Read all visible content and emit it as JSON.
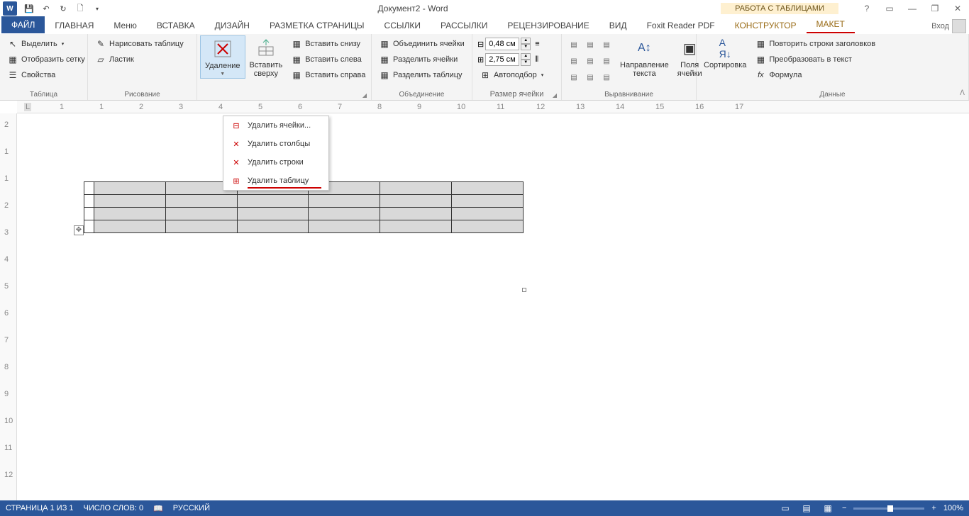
{
  "title": "Документ2 - Word",
  "contextTab": "РАБОТА С ТАБЛИЦАМИ",
  "tabs": {
    "file": "ФАЙЛ",
    "home": "ГЛАВНАЯ",
    "menu": "Меню",
    "insert": "ВСТАВКА",
    "design": "ДИЗАЙН",
    "layout": "РАЗМЕТКА СТРАНИЦЫ",
    "refs": "ССЫЛКИ",
    "mail": "РАССЫЛКИ",
    "review": "РЕЦЕНЗИРОВАНИЕ",
    "view": "ВИД",
    "foxit": "Foxit Reader PDF",
    "constructor": "КОНСТРУКТОР",
    "maket": "МАКЕТ",
    "signin": "Вход"
  },
  "groups": {
    "table": {
      "label": "Таблица",
      "select": "Выделить",
      "grid": "Отобразить сетку",
      "props": "Свойства"
    },
    "draw": {
      "label": "Рисование",
      "draw": "Нарисовать таблицу",
      "eraser": "Ластик"
    },
    "delete": {
      "btn": "Удаление"
    },
    "insert": {
      "above": "Вставить сверху",
      "below": "Вставить снизу",
      "left": "Вставить слева",
      "right": "Вставить справа"
    },
    "merge": {
      "label": "Объединение",
      "merge": "Объединить ячейки",
      "splitcells": "Разделить ячейки",
      "splittable": "Разделить таблицу"
    },
    "size": {
      "label": "Размер ячейки",
      "h": "0,48 см",
      "w": "2,75 см",
      "autofit": "Автоподбор"
    },
    "align": {
      "label": "Выравнивание",
      "dir": "Направление текста",
      "margins": "Поля ячейки"
    },
    "data": {
      "label": "Данные",
      "sort": "Сортировка",
      "repeat": "Повторить строки заголовков",
      "convert": "Преобразовать в текст",
      "formula": "Формула"
    }
  },
  "dropdown": {
    "cells": "Удалить ячейки...",
    "cols": "Удалить столбцы",
    "rows": "Удалить строки",
    "table": "Удалить таблицу"
  },
  "status": {
    "page": "СТРАНИЦА 1 ИЗ 1",
    "words": "ЧИСЛО СЛОВ: 0",
    "lang": "РУССКИЙ",
    "zoom": "100%"
  },
  "ruler_h": [
    "1",
    "1",
    "2",
    "3",
    "4",
    "5",
    "6",
    "7",
    "8",
    "9",
    "10",
    "11",
    "12",
    "13",
    "14",
    "15",
    "16",
    "17"
  ],
  "ruler_v": [
    "2",
    "1",
    "1",
    "2",
    "3",
    "4",
    "5",
    "6",
    "7",
    "8",
    "9",
    "10",
    "11",
    "12"
  ]
}
